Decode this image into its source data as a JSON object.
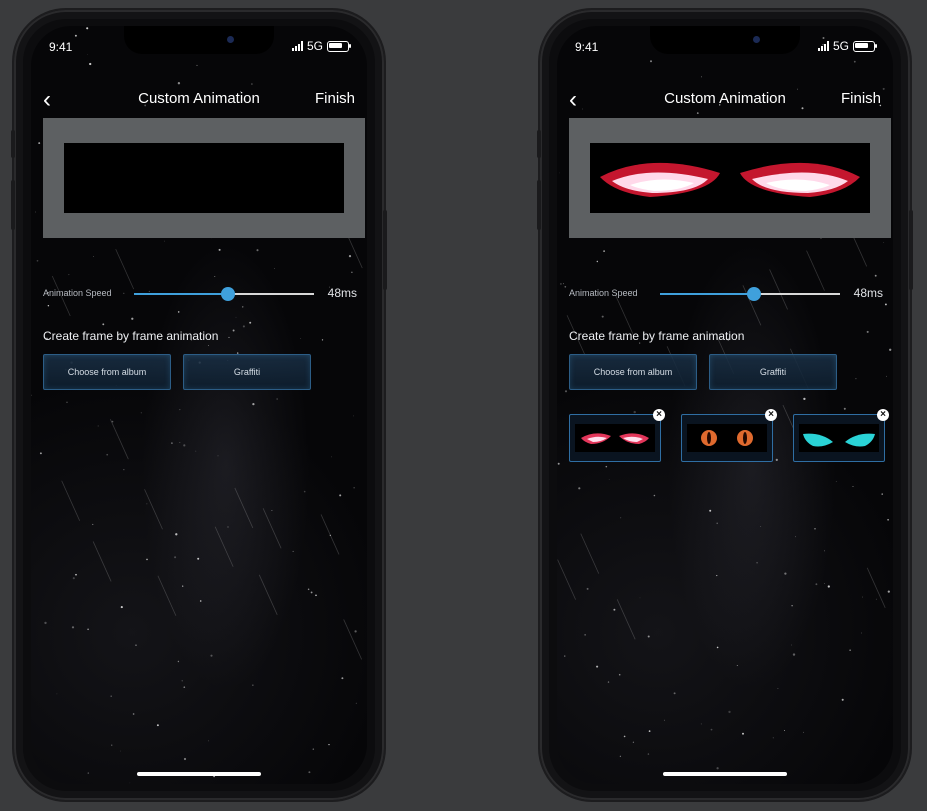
{
  "status": {
    "time": "9:41",
    "network": "5G"
  },
  "nav": {
    "back_icon": "chevron-left-icon",
    "title": "Custom Animation",
    "finish_label": "Finish"
  },
  "speed": {
    "label": "Animation Speed",
    "value_text": "48ms",
    "level": 0.52
  },
  "section": {
    "heading": "Create frame by frame animation"
  },
  "buttons": {
    "album_label": "Choose from album",
    "graffiti_label": "Graffiti"
  },
  "frames": [
    {
      "name": "frame-red-eyes",
      "eye_color": "#e3365a",
      "delete_icon": "close-icon",
      "delete_glyph": "×"
    },
    {
      "name": "frame-orange-eyes",
      "eye_color": "#e06a2e",
      "delete_icon": "close-icon",
      "delete_glyph": "×"
    },
    {
      "name": "frame-cyan-eyes",
      "eye_color": "#2ad3d6",
      "delete_icon": "close-icon",
      "delete_glyph": "×"
    }
  ],
  "colors": {
    "accent": "#3fa0dc",
    "background": "#3a3b3d",
    "preview_frame": "#5d6062"
  }
}
